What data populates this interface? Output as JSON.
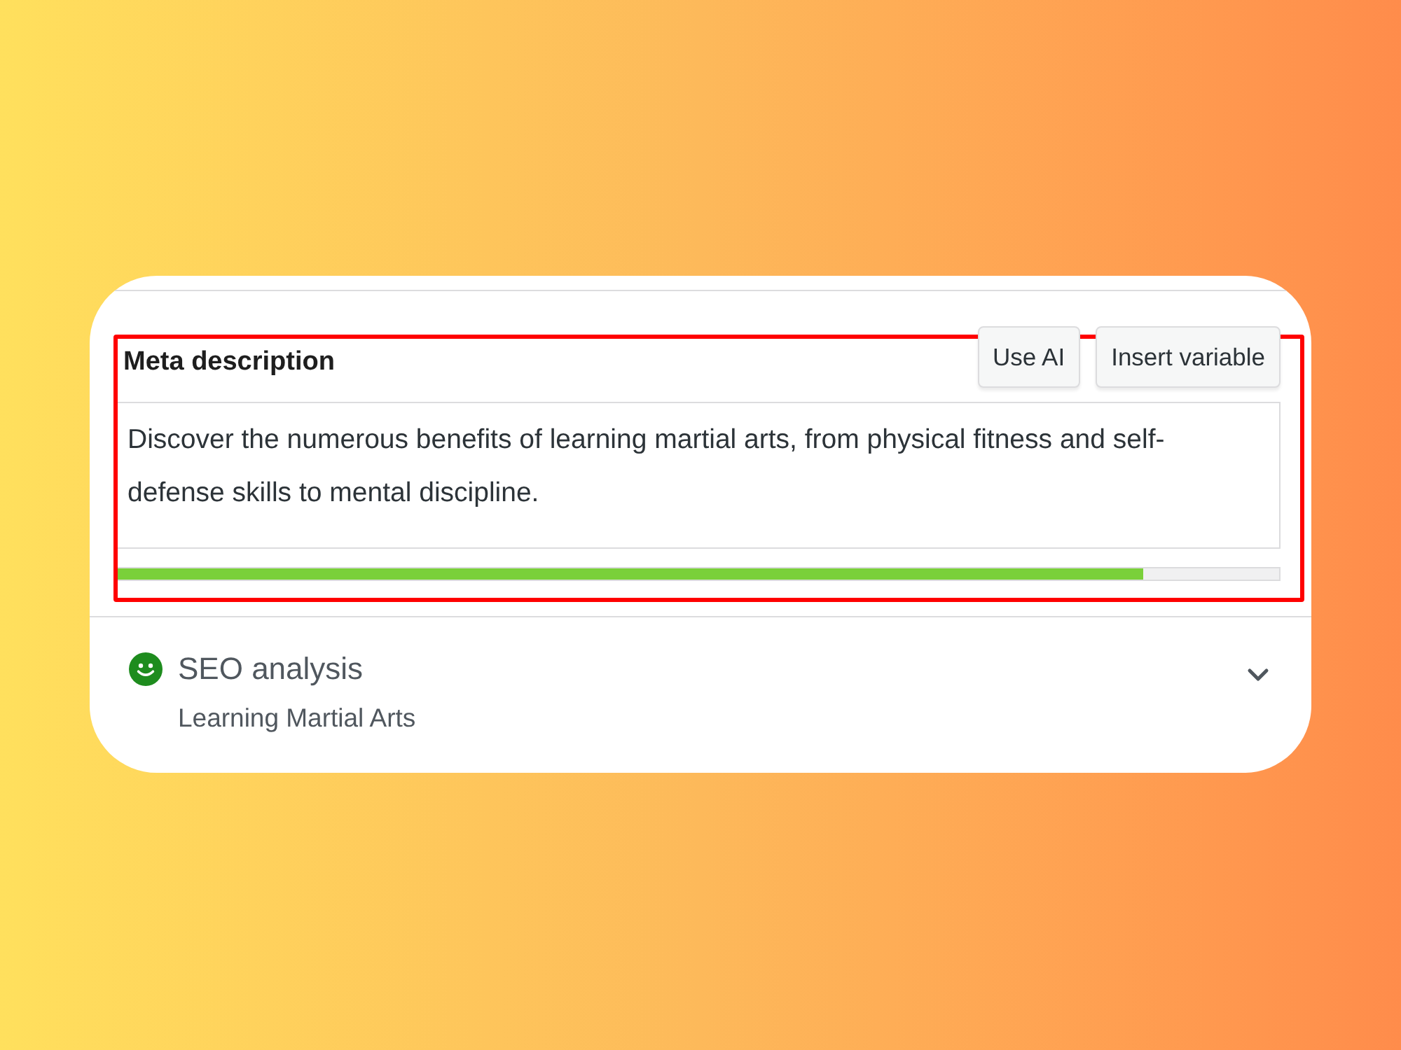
{
  "meta_description": {
    "label": "Meta description",
    "highlighted": true,
    "buttons": [
      {
        "label": "Use AI"
      },
      {
        "label": "Insert variable"
      }
    ],
    "value": "Discover the numerous benefits of learning martial arts, from physical fitness and self-defense skills to mental discipline.",
    "progress": {
      "level": 0.883
    }
  },
  "seo_analysis": {
    "kind": "good",
    "title": "SEO analysis",
    "keyphrase": "Learning Martial Arts",
    "expanded": false
  }
}
